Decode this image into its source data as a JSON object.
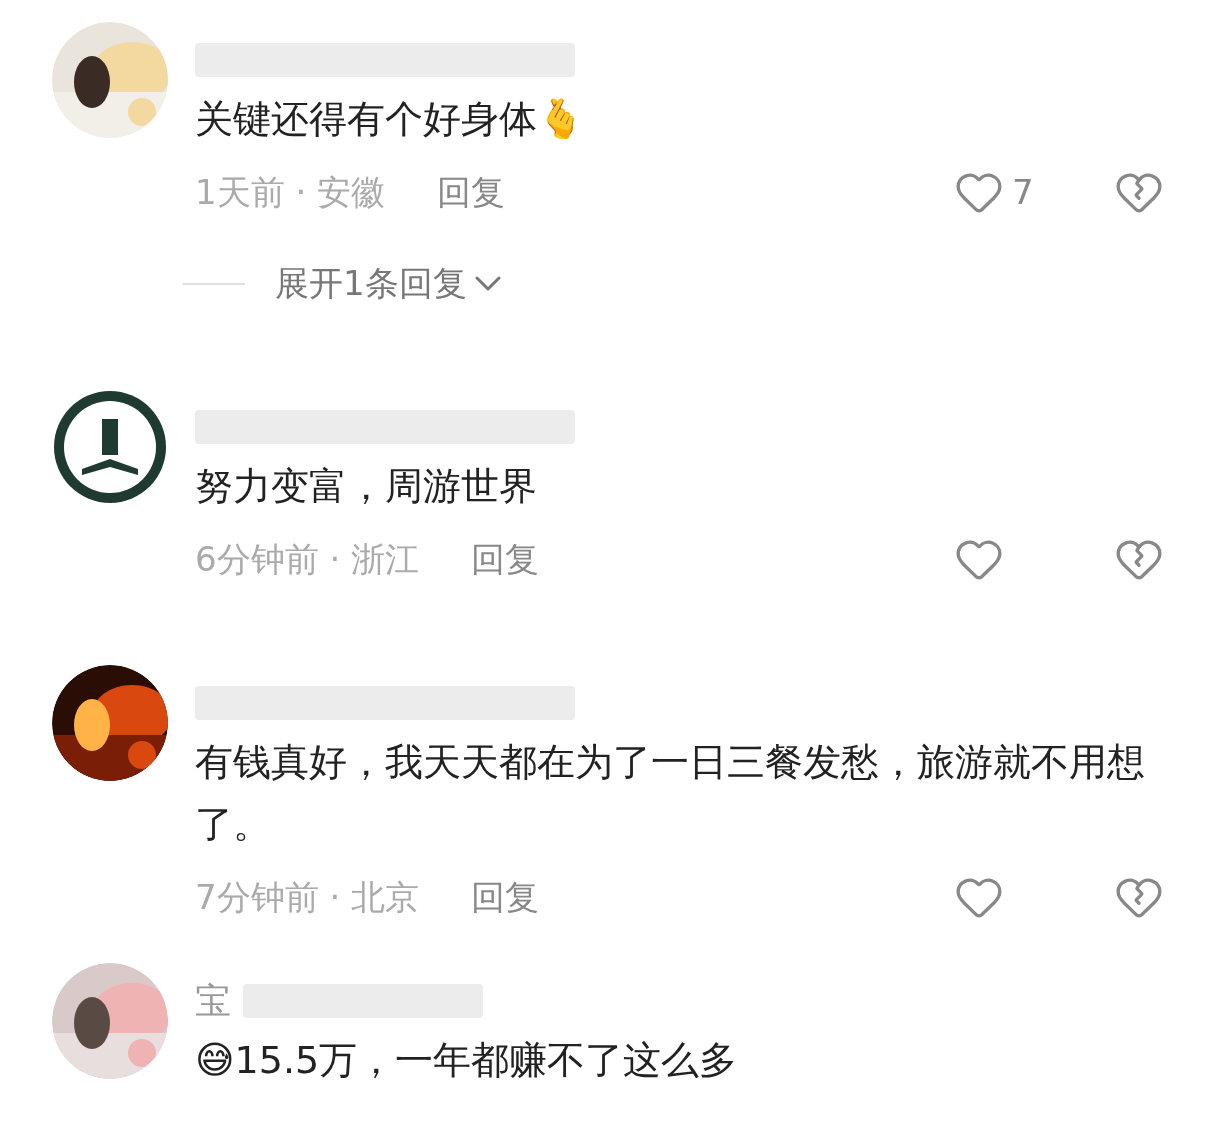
{
  "comments": [
    {
      "text": "关键还得有个好身体🫰",
      "meta": "1天前 · 安徽",
      "reply": "回复",
      "likes": "7",
      "expand": {
        "label": "展开1条回复"
      }
    },
    {
      "avatar": {
        "kind": "logo"
      },
      "text": "努力变富，周游世界",
      "meta": "6分钟前 · 浙江",
      "reply": "回复"
    },
    {
      "text": "有钱真好，我天天都在为了一日三餐发愁，旅游就不用想了。",
      "meta": "7分钟前 · 北京",
      "reply": "回复"
    },
    {
      "username": "宝",
      "text": "😅15.5万，一年都赚不了这么多"
    }
  ]
}
